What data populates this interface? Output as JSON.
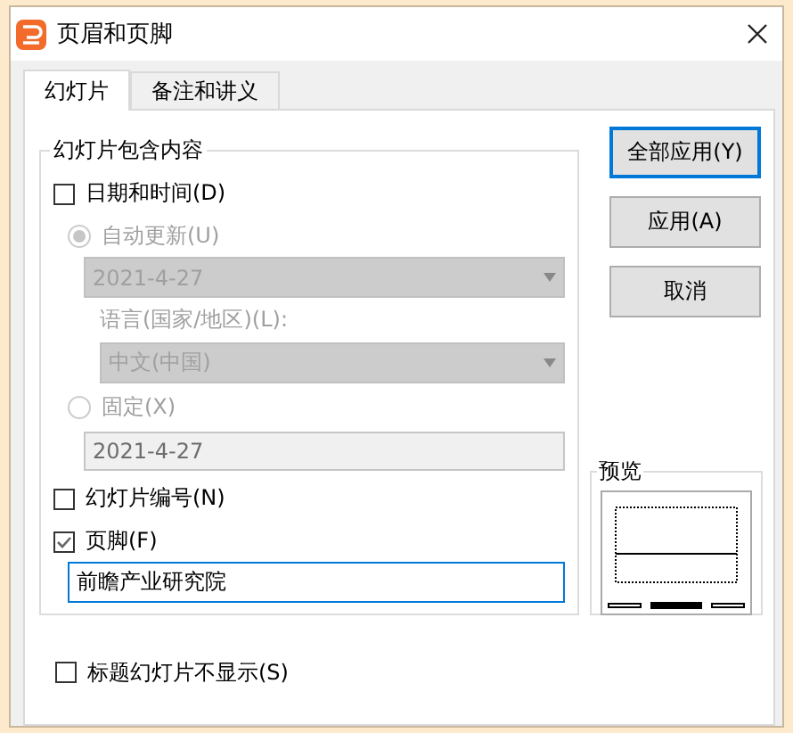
{
  "window": {
    "title": "页眉和页脚"
  },
  "tabs": [
    {
      "label": "幻灯片",
      "selected": true
    },
    {
      "label": "备注和讲义",
      "selected": false
    }
  ],
  "slide_content": {
    "title": "幻灯片包含内容",
    "date_time": {
      "label": "日期和时间(D)",
      "checked": false
    },
    "date_options": {
      "disabled": true,
      "auto_update": {
        "label": "自动更新(U)",
        "selected": true
      },
      "auto_date": {
        "value": "2021-4-27"
      },
      "language_label": "语言(国家/地区)(L):",
      "language": {
        "value": "中文(中国)"
      },
      "fixed": {
        "label": "固定(X)",
        "selected": false
      },
      "fixed_date": {
        "value": "2021-4-27"
      }
    },
    "slide_number": {
      "label": "幻灯片编号(N)",
      "checked": false
    },
    "footer": {
      "label": "页脚(F)",
      "checked": true
    },
    "footer_text": {
      "value": "前瞻产业研究院"
    }
  },
  "hide_on_title": {
    "label": "标题幻灯片不显示(S)",
    "checked": false
  },
  "buttons": [
    {
      "label": "全部应用(Y)",
      "default": true
    },
    {
      "label": "应用(A)",
      "default": false
    },
    {
      "label": "取消",
      "default": false
    }
  ],
  "preview": {
    "title": "预览"
  }
}
